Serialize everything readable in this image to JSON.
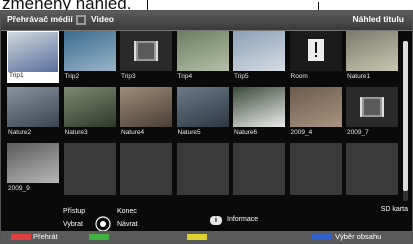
{
  "callout": {
    "text": "změněný náhled."
  },
  "header": {
    "app_title": "Přehrávač médií",
    "section": "Video",
    "right_title": "Náhled titulu"
  },
  "thumbnails": [
    {
      "label": "Trip1",
      "type": "photo",
      "colors": [
        "#cfd8e0",
        "#58709a"
      ],
      "selected": true
    },
    {
      "label": "Trip2",
      "type": "photo",
      "colors": [
        "#3a6c8c",
        "#9ab4c8"
      ]
    },
    {
      "label": "Trip3",
      "type": "film",
      "colors": [
        "#4a4a4a",
        "#9a9a9a"
      ]
    },
    {
      "label": "Trip4",
      "type": "photo",
      "colors": [
        "#6a7e5e",
        "#b6c0a8"
      ]
    },
    {
      "label": "Trip5",
      "type": "photo",
      "colors": [
        "#8aa0b8",
        "#d6dce4"
      ]
    },
    {
      "label": "Room",
      "type": "alert",
      "colors": [
        "#3a3a3a",
        "#1a1a1a"
      ]
    },
    {
      "label": "Nature1",
      "type": "photo",
      "colors": [
        "#7a7a6a",
        "#c8c8b0"
      ]
    },
    {
      "label": "Nature2",
      "type": "photo",
      "colors": [
        "#8894a0",
        "#3a4450"
      ]
    },
    {
      "label": "Nature3",
      "type": "photo",
      "colors": [
        "#7e8a6e",
        "#2e3a2a"
      ]
    },
    {
      "label": "Nature4",
      "type": "photo",
      "colors": [
        "#a08c78",
        "#4a3e34"
      ]
    },
    {
      "label": "Nature5",
      "type": "photo",
      "colors": [
        "#6a7a8a",
        "#2e3844"
      ]
    },
    {
      "label": "Nature6",
      "type": "photo",
      "colors": [
        "#3a4a3a",
        "#ececec"
      ]
    },
    {
      "label": "2009_4",
      "type": "photo",
      "colors": [
        "#6e5a4a",
        "#a89480"
      ]
    },
    {
      "label": "2009_7",
      "type": "film",
      "colors": [
        "#4a4a4a",
        "#9a9a9a"
      ]
    },
    {
      "label": "2009_9",
      "type": "photo",
      "colors": [
        "#5a5a5a",
        "#b8b8b8"
      ]
    },
    {
      "label": "",
      "type": "empty"
    },
    {
      "label": "",
      "type": "empty"
    },
    {
      "label": "",
      "type": "empty"
    },
    {
      "label": "",
      "type": "empty"
    },
    {
      "label": "",
      "type": "empty"
    },
    {
      "label": "",
      "type": "empty"
    }
  ],
  "help": {
    "access": "Přístup",
    "select": "Vybrat",
    "exit": "Konec",
    "back": "Návrat",
    "info_icon": "i",
    "info": "Informace",
    "sd_card": "SD karta"
  },
  "footer": {
    "red_label": "Přehrát",
    "yellow_label": "Výběr obsahu",
    "colors": [
      "#e04040",
      "#40b040",
      "#e0d030",
      "#3060d0"
    ]
  },
  "scroll": {
    "position": 0,
    "visible_fraction": 0.94
  }
}
